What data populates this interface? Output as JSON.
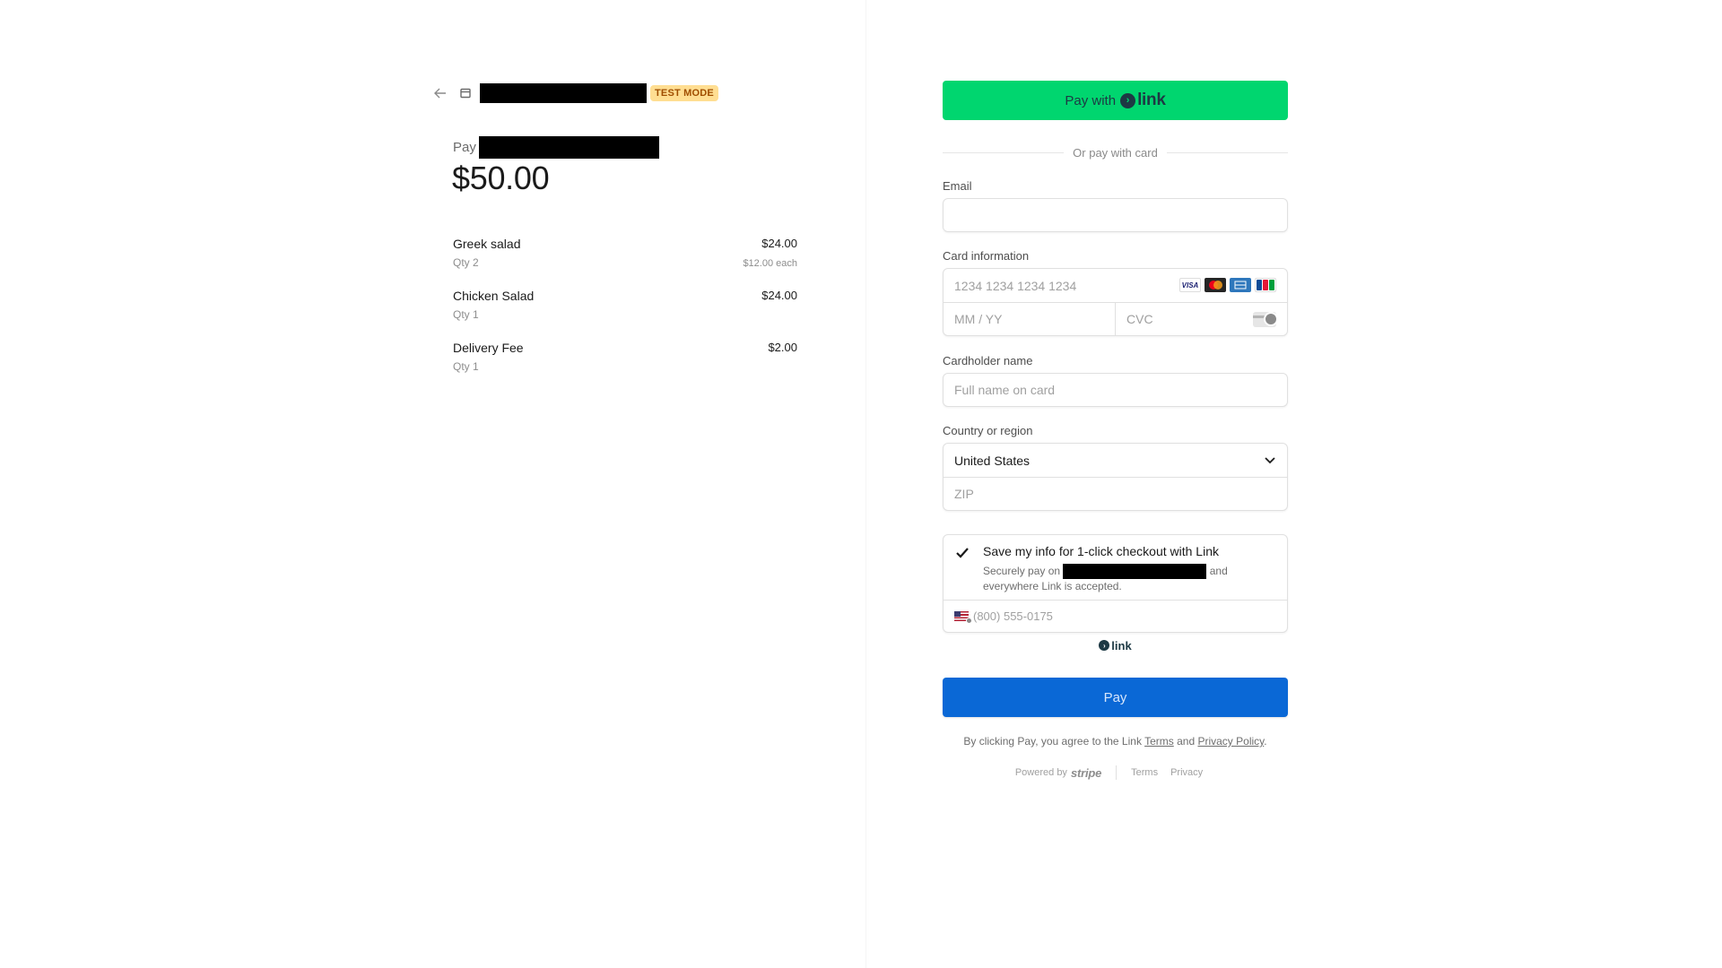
{
  "header": {
    "test_badge": "TEST MODE"
  },
  "summary": {
    "pay_label": "Pay",
    "total": "$50.00",
    "items": [
      {
        "name": "Greek salad",
        "qty": "Qty 2",
        "price": "$24.00",
        "each": "$12.00 each"
      },
      {
        "name": "Chicken Salad",
        "qty": "Qty 1",
        "price": "$24.00",
        "each": ""
      },
      {
        "name": "Delivery Fee",
        "qty": "Qty 1",
        "price": "$2.00",
        "each": ""
      }
    ]
  },
  "link_button": {
    "prefix": "Pay with",
    "brand": "link"
  },
  "divider_text": "Or pay with card",
  "email": {
    "label": "Email",
    "value": ""
  },
  "card": {
    "label": "Card information",
    "number_placeholder": "1234 1234 1234 1234",
    "expiry_placeholder": "MM / YY",
    "cvc_placeholder": "CVC",
    "brands": [
      "VISA",
      "mastercard",
      "amex",
      "jcb"
    ]
  },
  "cardholder": {
    "label": "Cardholder name",
    "placeholder": "Full name on card"
  },
  "country": {
    "label": "Country or region",
    "selected": "United States",
    "zip_placeholder": "ZIP"
  },
  "save_info": {
    "title": "Save my info for 1-click checkout with Link",
    "sub_before": "Securely pay on",
    "sub_after": "and",
    "sub_line2": "everywhere Link is accepted.",
    "phone_placeholder": "(800) 555-0175",
    "checked": true
  },
  "link_mini": "link",
  "pay_button": "Pay",
  "legal": {
    "prefix": "By clicking Pay, you agree to the Link",
    "terms": "Terms",
    "and": "and",
    "privacy": "Privacy Policy",
    "suffix": "."
  },
  "footer": {
    "powered_by": "Powered by",
    "stripe": "stripe",
    "terms": "Terms",
    "privacy": "Privacy"
  },
  "colors": {
    "link_green": "#00d66f",
    "pay_blue": "#0a68d6",
    "test_badge_bg": "#ffde92"
  }
}
